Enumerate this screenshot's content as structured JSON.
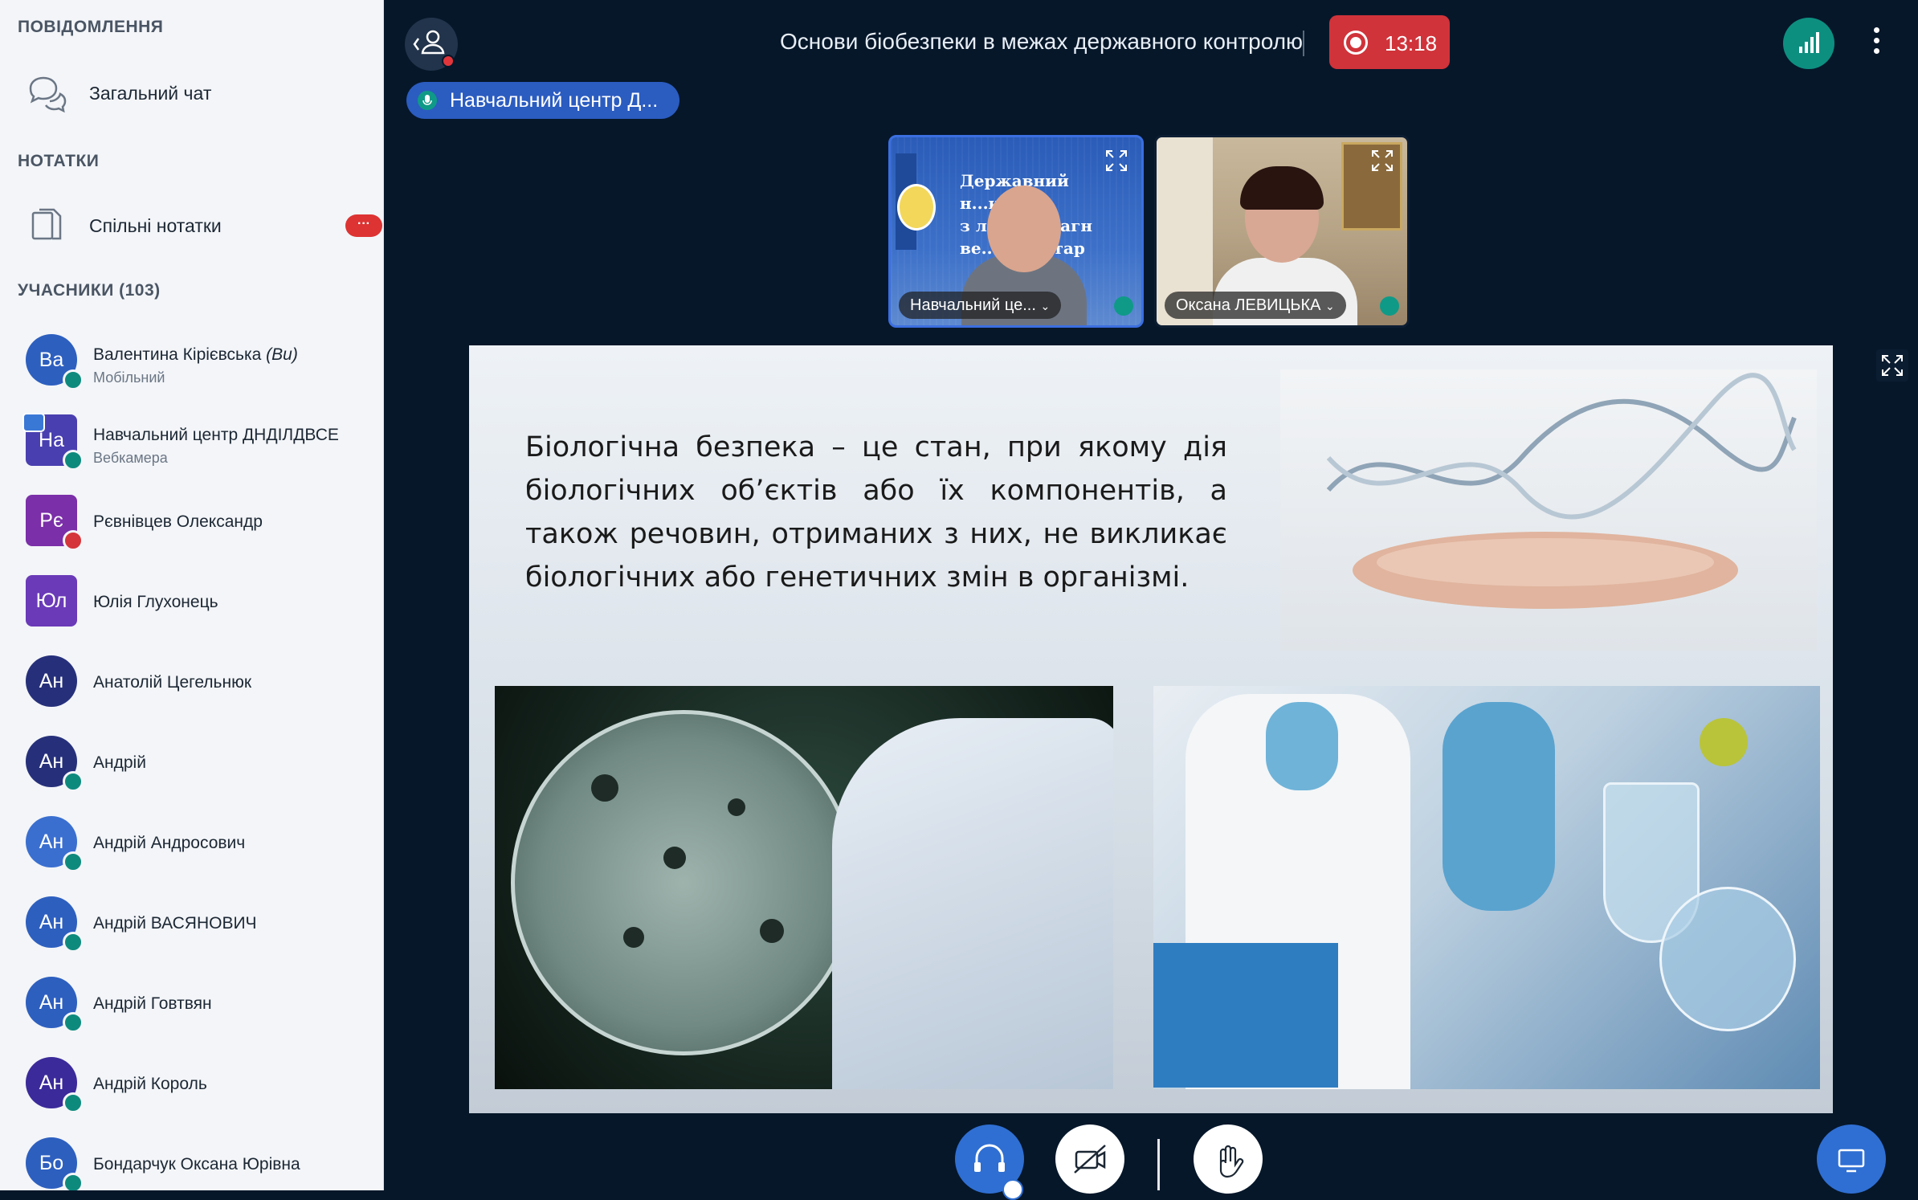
{
  "sidebar": {
    "messages_title": "ПОВІДОМЛЕННЯ",
    "public_chat": "Загальний чат",
    "notes_title": "НОТАТКИ",
    "shared_notes": "Спільні нотатки",
    "notes_badge": "···",
    "participants_title": "УЧАСНИКИ (103)",
    "users": [
      {
        "initials": "Ва",
        "name": "Валентина Кірієвська",
        "you": "(Ви)",
        "sub": "Мобільний",
        "color": "#2d5fbf",
        "status": "audio"
      },
      {
        "initials": "На",
        "name": "Навчальний центр ДНДІЛДВСЕ",
        "sub": "Вебкамера",
        "color": "#4a3fb0",
        "status": "mic",
        "square": true,
        "presenter": true
      },
      {
        "initials": "Рє",
        "name": "Рєвнівцев Олександр",
        "sub": "",
        "color": "#7b2fa8",
        "status": "muted",
        "square": true
      },
      {
        "initials": "Юл",
        "name": "Юлія Глухонець",
        "sub": "",
        "color": "#6a3ab8",
        "status": "",
        "square": true
      },
      {
        "initials": "Ан",
        "name": "Анатолій Цегельнюк",
        "sub": "",
        "color": "#26307a",
        "status": ""
      },
      {
        "initials": "Ан",
        "name": "Андрій",
        "sub": "",
        "color": "#26307a",
        "status": "audio"
      },
      {
        "initials": "Ан",
        "name": "Андрій Андросович",
        "sub": "",
        "color": "#3a6fd0",
        "status": "audio"
      },
      {
        "initials": "Ан",
        "name": "Андрій ВАСЯНОВИЧ",
        "sub": "",
        "color": "#2d5fbf",
        "status": "audio"
      },
      {
        "initials": "Ан",
        "name": "Андрій Говтвян",
        "sub": "",
        "color": "#2d5fbf",
        "status": "audio"
      },
      {
        "initials": "Ан",
        "name": "Андрій Король",
        "sub": "",
        "color": "#3b2a9a",
        "status": "audio"
      },
      {
        "initials": "Бо",
        "name": "Бондарчук Оксана Юрівна",
        "sub": "",
        "color": "#2d5fbf",
        "status": "audio"
      }
    ]
  },
  "header": {
    "title": "Основи біобезпеки в межах державного контролю",
    "rec_time": "13:18"
  },
  "talking": "Навчальний центр Д...",
  "videos": [
    {
      "name": "Навчальний це...",
      "banner": "Державний н...ково-\nз л... ної діагн\nве...о-санітар"
    },
    {
      "name": "Оксана ЛЕВИЦЬКА"
    }
  ],
  "slide": {
    "text": "Біологічна безпека – це стан, при якому дія біологічних об’єктів або їх компонентів, а також речовин, отриманих з них, не викликає біологічних або генетичних змін в організмі."
  },
  "colors": {
    "accent": "#2f6fd3",
    "record": "#d0333a",
    "ok": "#0d8f80",
    "bg": "#06172a"
  }
}
